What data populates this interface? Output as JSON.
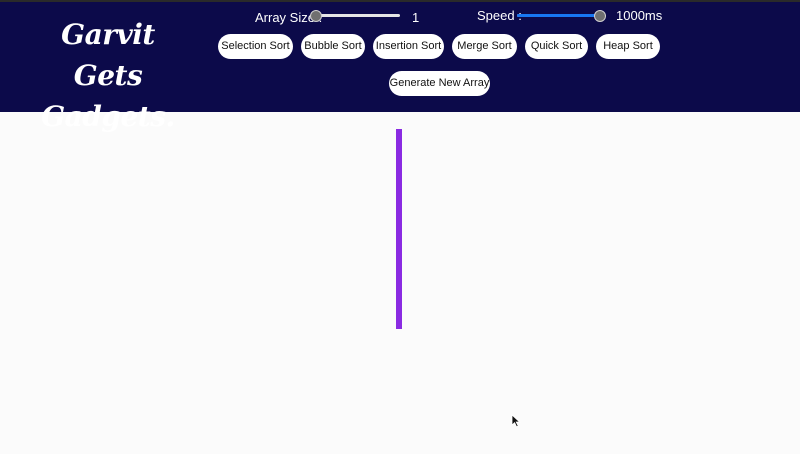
{
  "logo": {
    "text": "Garvit Gets\nGadgets."
  },
  "controls": {
    "array_size": {
      "label": "Array Size :",
      "value": "1",
      "level": 0
    },
    "speed": {
      "label": "Speed :",
      "value": "1000ms",
      "level": 1
    }
  },
  "buttons": {
    "selection_sort": "Selection Sort",
    "bubble_sort": "Bubble Sort",
    "insertion_sort": "Insertion Sort",
    "merge_sort": "Merge Sort",
    "quick_sort": "Quick Sort",
    "heap_sort": "Heap Sort",
    "generate_new_array": "Generate New Array"
  },
  "array": {
    "values": [
      1
    ],
    "bar_color": "#8a2be2"
  },
  "colors": {
    "header_bg": "#0c0a4a",
    "slider_fill": "#1877f2"
  }
}
